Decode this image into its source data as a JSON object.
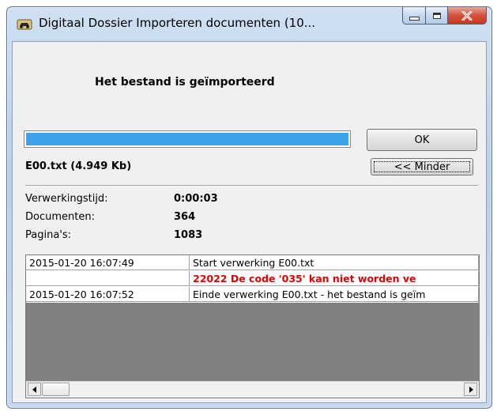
{
  "window": {
    "title": "Digitaal Dossier Importeren documenten (10...",
    "icon": "car-icon"
  },
  "status": {
    "message": "Het bestand is geïmporteerd",
    "progress_fraction": 1.0,
    "file": "E00.txt (4.949 Kb)"
  },
  "buttons": {
    "ok": "OK",
    "less": "<< Minder"
  },
  "stats": {
    "processing_time_label": "Verwerkingstijd:",
    "processing_time_value": "0:00:03",
    "documents_label": "Documenten:",
    "documents_value": "364",
    "pages_label": "Pagina's:",
    "pages_value": "1083"
  },
  "log": [
    {
      "time": "2015-01-20 16:07:49",
      "message": "Start verwerking E00.txt",
      "error": false
    },
    {
      "time": "",
      "message": "22022 De code '035' kan niet worden ve",
      "error": true
    },
    {
      "time": "2015-01-20 16:07:52",
      "message": "Einde verwerking E00.txt - het bestand is geïm",
      "error": false
    }
  ],
  "colors": {
    "progress": "#3ca2ea",
    "error_text": "#e00000"
  }
}
